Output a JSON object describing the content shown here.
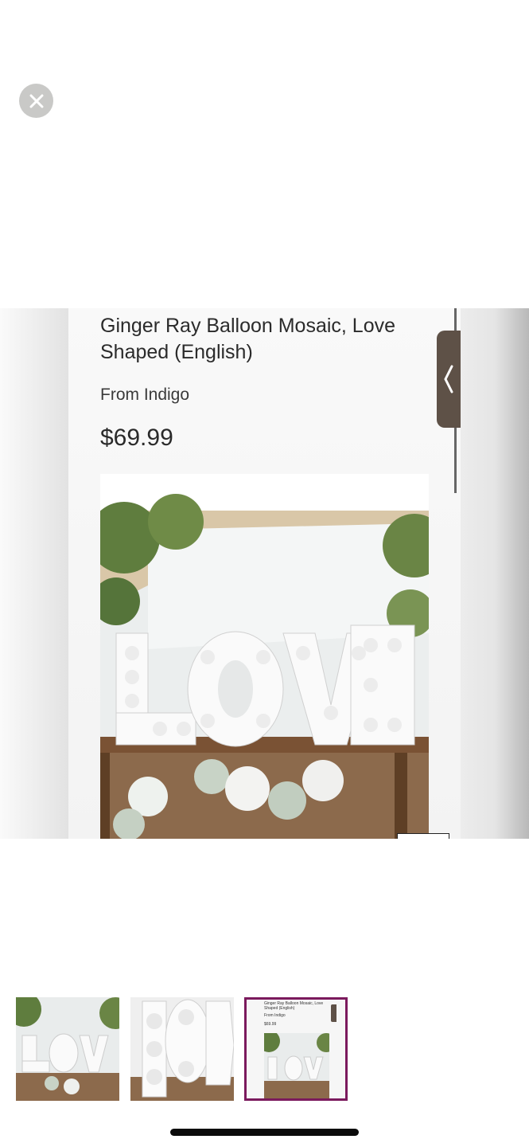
{
  "close": {
    "icon": "close-icon"
  },
  "product": {
    "title": "Ginger Ray Balloon Mosaic, Love Shaped (English)",
    "vendor": "From Indigo",
    "price": "$69.99"
  },
  "side_tab": {
    "icon": "chevron-left-icon"
  },
  "thumbnails": [
    {
      "label": "LOVE balloon mosaic on table"
    },
    {
      "label": "Balloon mosaic letters close-up"
    },
    {
      "label": "Product page screenshot",
      "title": "Ginger Ray Balloon Mosaic, Love Shaped (English)",
      "vendor": "From Indigo",
      "price": "$69.99",
      "selected": true
    }
  ],
  "colors": {
    "accent": "#7b1a5d",
    "tab": "#5e5147",
    "close_bg": "#c9c9c7"
  }
}
